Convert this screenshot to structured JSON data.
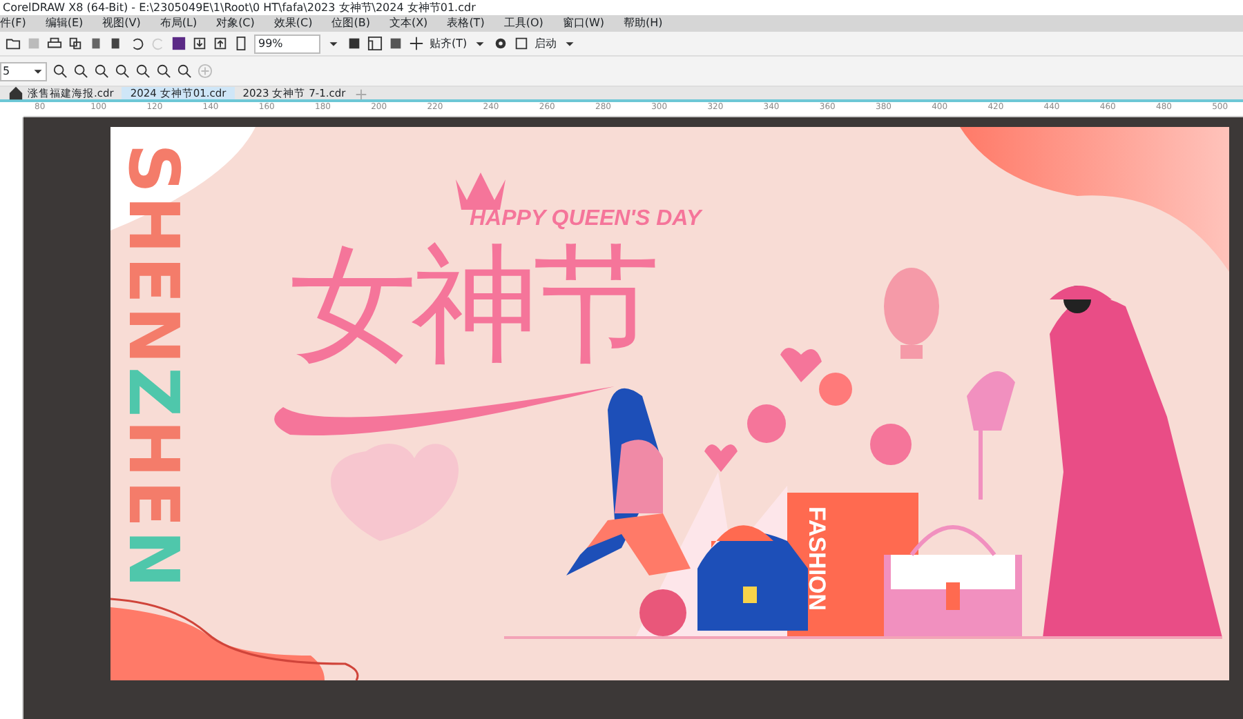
{
  "window": {
    "title": "CorelDRAW X8 (64-Bit) - E:\\2305049E\\1\\Root\\0 HT\\fafa\\2023 女神节\\2024 女神节01.cdr"
  },
  "menu": [
    "件(F)",
    "编辑(E)",
    "视图(V)",
    "布局(L)",
    "对象(C)",
    "效果(C)",
    "位图(B)",
    "文本(X)",
    "表格(T)",
    "工具(O)",
    "窗口(W)",
    "帮助(H)"
  ],
  "toolbar": {
    "zoom": "99%",
    "snap": "贴齐(T)",
    "launch": "启动"
  },
  "property_bar": {
    "field": "5"
  },
  "tabs": [
    {
      "label": "涨售福建海报.cdr",
      "selected": false,
      "home": true
    },
    {
      "label": "2024 女神节01.cdr",
      "selected": true,
      "home": false
    },
    {
      "label": "2023 女神节 7-1.cdr",
      "selected": false,
      "home": false
    }
  ],
  "ruler": {
    "labels": [
      "80",
      "100",
      "120",
      "140",
      "160",
      "180",
      "200",
      "220",
      "240",
      "260",
      "280",
      "300",
      "320",
      "340",
      "360",
      "380",
      "400",
      "420",
      "440",
      "460",
      "480",
      "500"
    ]
  },
  "artwork": {
    "title": "女神节",
    "subtitle": "HAPPY QUEEN'S DAY",
    "bag_text": "FASHION",
    "vertical_text": [
      {
        "text": "SHEN",
        "color": "#f47c6a"
      },
      {
        "text": "Z",
        "color": "#4fc7ab"
      },
      {
        "text": "HE",
        "color": "#f47c6a"
      },
      {
        "text": "N",
        "color": "#4fc7ab"
      }
    ]
  }
}
